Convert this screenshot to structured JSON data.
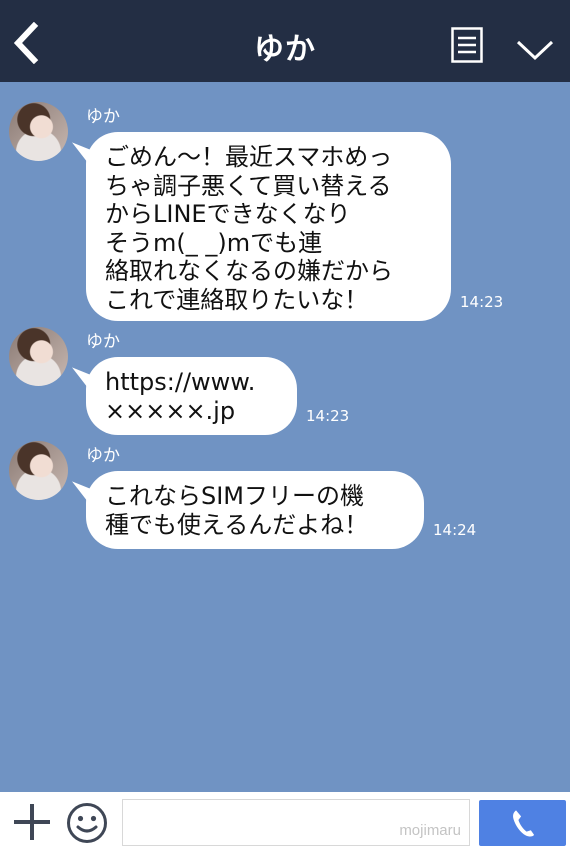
{
  "header": {
    "title": "ゆか",
    "back_icon": "chevron-left-icon",
    "menu_icon": "list-icon",
    "expand_icon": "chevron-down-icon"
  },
  "messages": [
    {
      "sender": "ゆか",
      "lines": [
        "ごめん〜！最近スマホめっ",
        "ちゃ調子悪くて買い替える",
        "からLINEできなくなり",
        "そうm(_ _)mでも連",
        "絡取れなくなるの嫌だから",
        "これで連絡取りたいな！"
      ],
      "time": "14:23"
    },
    {
      "sender": "ゆか",
      "lines": [
        "https://www.",
        "×××××.jp"
      ],
      "time": "14:23"
    },
    {
      "sender": "ゆか",
      "lines": [
        "これならSIMフリーの機",
        "種でも使えるんだよね！"
      ],
      "time": "14:24"
    }
  ],
  "footer": {
    "plus_icon": "plus-icon",
    "emoji_icon": "smiley-icon",
    "input_value": "",
    "watermark": "mojimaru",
    "call_icon": "phone-icon"
  },
  "colors": {
    "header_bg": "#232e44",
    "chat_bg": "#7093c3",
    "bubble_bg": "#ffffff",
    "call_button": "#4f81e3"
  }
}
